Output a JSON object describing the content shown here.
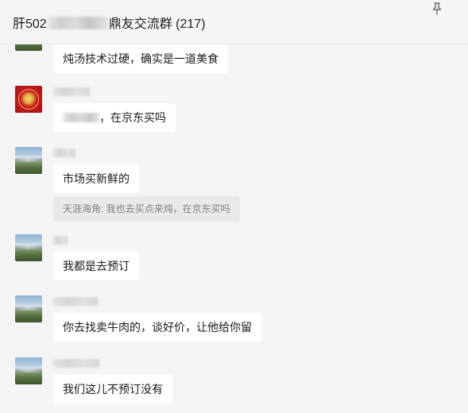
{
  "header": {
    "title_prefix": "肝502",
    "title_suffix": "鼎友交流群 (217)"
  },
  "messages": [
    {
      "text": "炖汤技术过硬，确实是一道美食",
      "avatar": "landscape"
    },
    {
      "text_after_blur": "，在京东买吗",
      "avatar": "red-seal"
    },
    {
      "text": "市场买新鲜的",
      "avatar": "landscape",
      "quote": "天涯海角: 我也去买点来炖，在京东买吗"
    },
    {
      "text": "我都是去预订",
      "avatar": "landscape"
    },
    {
      "text": "你去找卖牛肉的，谈好价，让他给你留",
      "avatar": "landscape"
    },
    {
      "text": "我们这儿不预订没有",
      "avatar": "landscape"
    }
  ],
  "icons": {
    "pin": "pin-icon"
  },
  "colors": {
    "background": "#f5f5f5",
    "bubble": "#ffffff",
    "quote_bg": "#e9e9e9",
    "quote_text": "#808080"
  }
}
